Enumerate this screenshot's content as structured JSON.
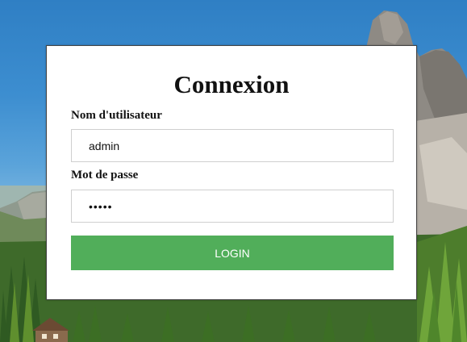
{
  "form": {
    "title": "Connexion",
    "username_label": "Nom d'utilisateur",
    "username_value": "admin",
    "password_label": "Mot de passe",
    "password_value": "admin",
    "login_label": "LOGIN"
  },
  "colors": {
    "button": "#51ae5a",
    "sky": "#3d8ed0"
  }
}
